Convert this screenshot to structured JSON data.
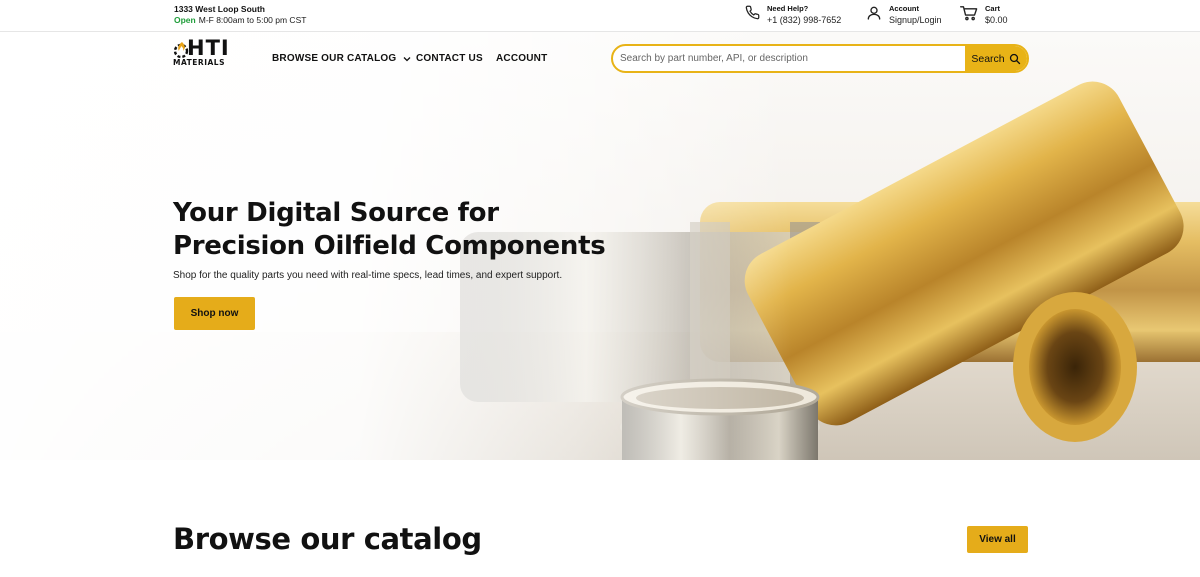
{
  "topbar": {
    "address_line1": "1333 West Loop South",
    "open_label": "Open",
    "hours": "M-F 8:00am to 5:00 pm CST",
    "help": {
      "label": "Need Help?",
      "phone": "+1 (832) 998-7652",
      "icon": "phone-icon"
    },
    "account": {
      "label": "Account",
      "action": "Signup/Login",
      "icon": "user-icon"
    },
    "cart": {
      "label": "Cart",
      "total": "$0.00",
      "icon": "cart-icon"
    }
  },
  "brand": {
    "name": "HTI",
    "sub": "MATERIALS",
    "icon": "flame-gear-icon"
  },
  "nav": {
    "catalog": "BROWSE OUR CATALOG",
    "contact": "CONTACT US",
    "account": "ACCOUNT"
  },
  "search": {
    "placeholder": "Search by part number, API, or description",
    "value": "",
    "button_label": "Search"
  },
  "hero": {
    "headline_line1": "Your Digital Source for",
    "headline_line2": "Precision Oilfield Components",
    "subtext": "Shop for the quality parts you need with real-time specs, lead times, and expert support.",
    "cta": "Shop now"
  },
  "browse": {
    "title": "Browse our catalog",
    "view_all": "View all"
  },
  "colors": {
    "accent": "#e8b317",
    "open_green": "#1f9d3a",
    "text": "#111111"
  }
}
